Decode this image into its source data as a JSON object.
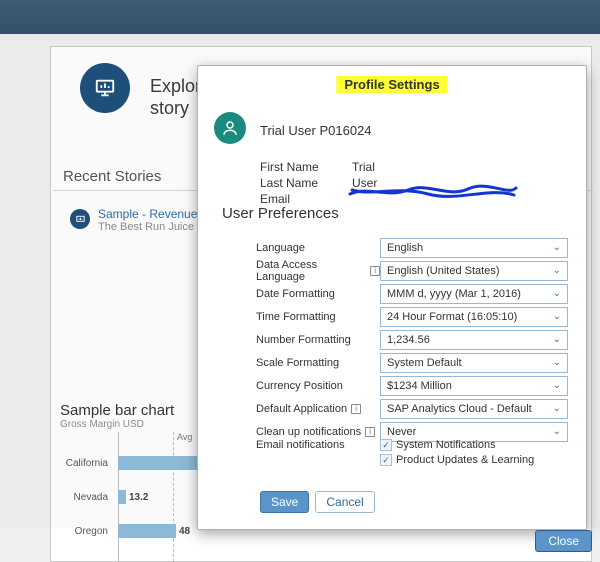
{
  "bg": {
    "explore_title": "Explore a sample story",
    "recent_heading": "Recent Stories",
    "sample_title": "Sample - Revenue Analysis",
    "sample_sub": "The Best Run Juice Company"
  },
  "chart_title": "Sample bar chart",
  "chart_sub": "Gross Margin USD",
  "chart_data": {
    "type": "bar",
    "orientation": "horizontal",
    "categories": [
      "California",
      "Nevada",
      "Oregon"
    ],
    "values": [
      null,
      13.2,
      48.0
    ],
    "avg_label": "Avg",
    "xlabel": "",
    "ylabel": ""
  },
  "modal": {
    "title": "Profile Settings",
    "username": "Trial User P016024",
    "first_name_label": "First Name",
    "first_name": "Trial",
    "last_name_label": "Last Name",
    "last_name": "User",
    "email_label": "Email",
    "prefs_heading": "User Preferences",
    "rows": {
      "language": {
        "label": "Language",
        "value": "English"
      },
      "data_lang": {
        "label": "Data Access Language",
        "value": "English (United States)"
      },
      "date_fmt": {
        "label": "Date Formatting",
        "value": "MMM d, yyyy (Mar 1, 2016)"
      },
      "time_fmt": {
        "label": "Time Formatting",
        "value": "24 Hour Format (16:05:10)"
      },
      "num_fmt": {
        "label": "Number Formatting",
        "value": "1,234.56"
      },
      "scale_fmt": {
        "label": "Scale Formatting",
        "value": "System Default"
      },
      "curr_pos": {
        "label": "Currency Position",
        "value": "$1234 Million"
      },
      "def_app": {
        "label": "Default Application",
        "value": "SAP Analytics Cloud - Default"
      },
      "cleanup": {
        "label": "Clean up notifications",
        "value": "Never"
      }
    },
    "email_notif_label": "Email notifications",
    "notif_system": "System Notifications",
    "notif_updates": "Product Updates & Learning",
    "save": "Save",
    "cancel": "Cancel"
  },
  "close_label": "Close"
}
